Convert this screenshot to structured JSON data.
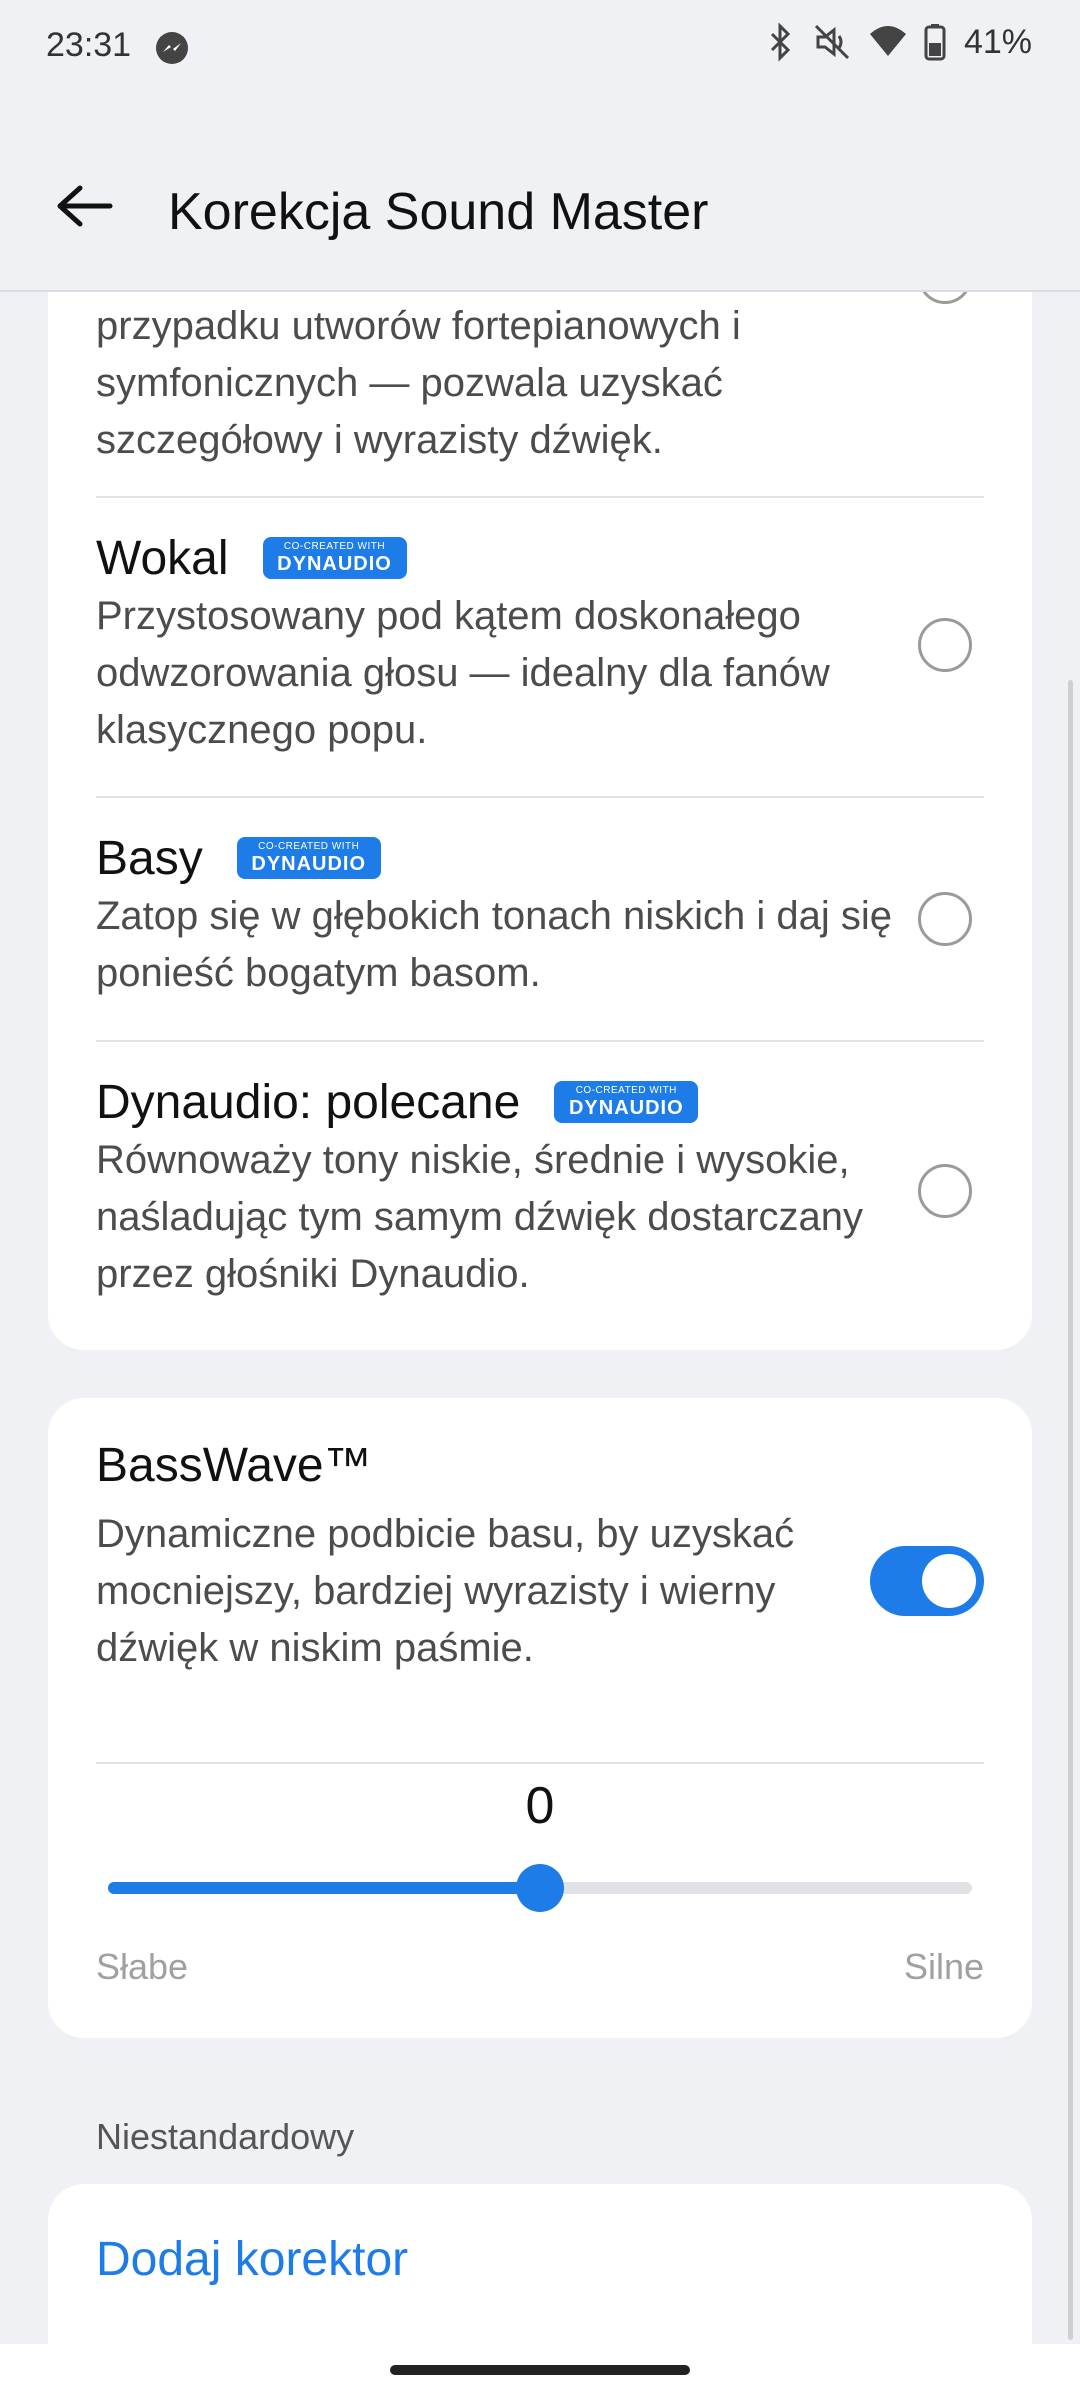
{
  "status_bar": {
    "time": "23:31",
    "icons": [
      "messenger-icon",
      "bluetooth-icon",
      "mute-icon",
      "wifi-icon",
      "battery-icon"
    ],
    "battery": "41%"
  },
  "app_bar": {
    "title": "Korekcja Sound Master",
    "back_icon": "arrow-back-icon"
  },
  "equalizer_presets": [
    {
      "title": "",
      "description": "przypadku utworów fortepianowych i symfonicznych — pozwala uzyskać szczegółowy i wyrazisty dźwięk.",
      "badge": false,
      "selected": false
    },
    {
      "title": "Wokal",
      "description": "Przystosowany pod kątem doskonałego odwzorowania głosu — idealny dla fanów klasycznego popu.",
      "badge": true,
      "selected": false
    },
    {
      "title": "Basy",
      "description": "Zatop się w głębokich tonach niskich i daj się ponieść bogatym basom.",
      "badge": true,
      "selected": false
    },
    {
      "title": "Dynaudio: polecane",
      "description": "Równoważy tony niskie, średnie i wysokie, naśladując tym samym dźwięk dostarczany przez głośniki Dynaudio.",
      "badge": true,
      "selected": false
    }
  ],
  "badge": {
    "top": "CO-CREATED WITH",
    "bottom": "DYNAUDIO",
    "color": "#1d7ce8"
  },
  "basswave": {
    "title": "BassWave™",
    "description": "Dynamiczne podbicie basu, by uzyskać mocniejszy, bardziej wyrazisty i wierny dźwięk w niskim paśmie.",
    "enabled": true,
    "value": "0",
    "level_fraction": 0.5,
    "min_label": "Słabe",
    "max_label": "Silne"
  },
  "custom_section": {
    "label": "Niestandardowy",
    "add_button": "Dodaj korektor"
  },
  "colors": {
    "accent": "#1d7ce8",
    "background": "#eff1f5"
  }
}
